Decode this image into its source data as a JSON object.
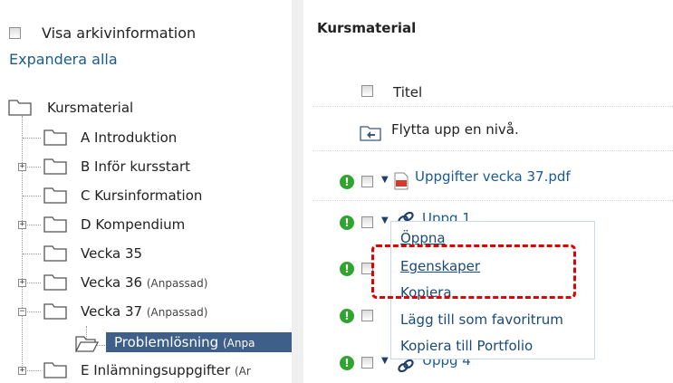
{
  "left": {
    "archive_checkbox_label": "Visa arkivinformation",
    "expand_all": "Expandera alla",
    "tree": {
      "root": "Kursmaterial",
      "items": [
        {
          "label": "A Introduktion",
          "sub": ""
        },
        {
          "label": "B Inför kursstart",
          "sub": ""
        },
        {
          "label": "C Kursinformation",
          "sub": ""
        },
        {
          "label": "D Kompendium",
          "sub": ""
        },
        {
          "label": "Vecka 35",
          "sub": ""
        },
        {
          "label": "Vecka 36",
          "sub": "(Anpassad)"
        },
        {
          "label": "Vecka 37",
          "sub": "(Anpassad)"
        },
        {
          "label": "Problemlösning",
          "sub": "(Anpa"
        },
        {
          "label": "E Inlämningsuppgifter",
          "sub": "(Ar"
        }
      ]
    }
  },
  "main": {
    "title": "Kursmaterial",
    "column_title": "Titel",
    "up_level": "Flytta upp en nivå.",
    "rows": [
      {
        "label": "Uppgifter vecka 37.pdf"
      },
      {
        "label": "Uppg 1"
      },
      {
        "label": ""
      },
      {
        "label": ""
      },
      {
        "label": "Uppg 4"
      }
    ],
    "excl_symbol": "!"
  },
  "context_menu": {
    "items": [
      "Öppna",
      "Egenskaper",
      "Kopiera",
      "Lägg till som favoritrum",
      "Kopiera till Portfolio"
    ]
  },
  "colors": {
    "selected_bg": "#3d5f8a",
    "highlight_dash": "#e00000",
    "excl_green": "#2fa52f",
    "link": "#1a5a92"
  }
}
